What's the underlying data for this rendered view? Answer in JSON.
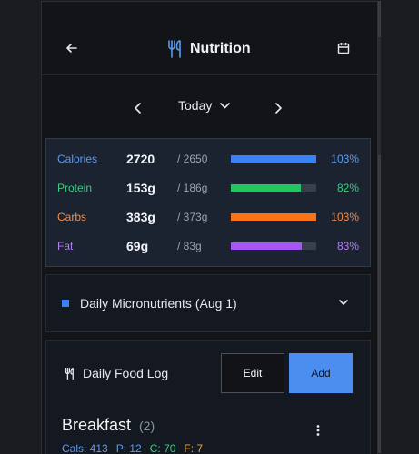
{
  "header": {
    "title": "Nutrition",
    "back_icon": "arrow-left-icon",
    "calendar_icon": "calendar-icon",
    "logo_icon": "utensils-icon"
  },
  "date_nav": {
    "label": "Today",
    "prev_icon": "chevron-left-icon",
    "next_icon": "chevron-right-icon",
    "dropdown_icon": "chevron-down-icon"
  },
  "macros": [
    {
      "name": "Calories",
      "value": "2720",
      "goal": "/ 2650",
      "percent_label": "103%",
      "fill": 1.0,
      "color": "#5b9bf0",
      "bar": "#3b82f6"
    },
    {
      "name": "Protein",
      "value": "153g",
      "goal": "/ 186g",
      "percent_label": "82%",
      "fill": 0.82,
      "color": "#35d07a",
      "bar": "#22c55e"
    },
    {
      "name": "Carbs",
      "value": "383g",
      "goal": "/ 373g",
      "percent_label": "103%",
      "fill": 1.0,
      "color": "#f58a45",
      "bar": "#f97316"
    },
    {
      "name": "Fat",
      "value": "69g",
      "goal": "/ 83g",
      "percent_label": "83%",
      "fill": 0.83,
      "color": "#b47df5",
      "bar": "#a855f7"
    }
  ],
  "micronutrients": {
    "label": "Daily Micronutrients (Aug 1)",
    "accent": "#3b82f6"
  },
  "food_log": {
    "title": "Daily Food Log",
    "edit_label": "Edit",
    "add_label": "Add",
    "meal": {
      "name": "Breakfast",
      "count": "(2)",
      "stats": [
        {
          "text": "Cals: 413",
          "color": "#5b9bf0"
        },
        {
          "text": "P: 12",
          "color": "#5b9bf0"
        },
        {
          "text": "C: 70",
          "color": "#35d07a"
        },
        {
          "text": "F: 7",
          "color": "#f5a623"
        }
      ]
    }
  }
}
